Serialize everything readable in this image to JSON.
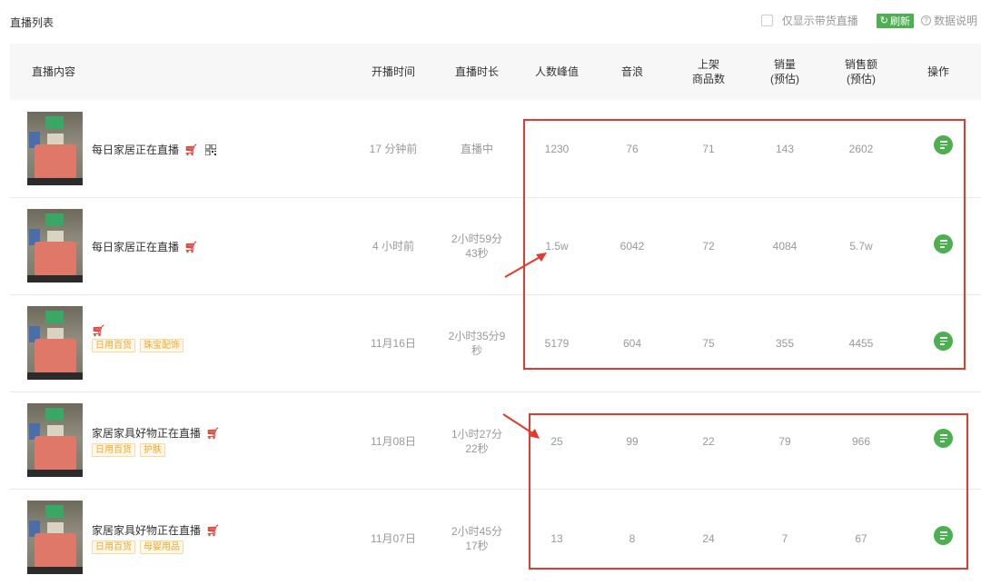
{
  "header": {
    "title": "直播列表",
    "only_goods_label": "仅显示带货直播",
    "refresh_label": "刷新",
    "refresh_icon": "refresh-icon",
    "help_label": "数据说明",
    "help_icon": "help-circle-icon"
  },
  "columns": {
    "content": "直播内容",
    "start_time": "开播时间",
    "duration": "直播时长",
    "peak_viewers": "人数峰值",
    "sound_wave": "音浪",
    "products": "上架\n商品数",
    "sales": "销量\n(预估)",
    "revenue": "销售额\n(预估)",
    "ops": "操作"
  },
  "rows": [
    {
      "title": "每日家居正在直播",
      "tags": [],
      "has_qr": true,
      "start_time": "17 分钟前",
      "duration": "直播中",
      "peak_viewers": "1230",
      "sound_wave": "76",
      "products": "71",
      "sales": "143",
      "revenue": "2602"
    },
    {
      "title": "每日家居正在直播",
      "tags": [],
      "has_qr": false,
      "start_time": "4 小时前",
      "duration": "2小时59分\n43秒",
      "peak_viewers": "1.5w",
      "sound_wave": "6042",
      "products": "72",
      "sales": "4084",
      "revenue": "5.7w"
    },
    {
      "title": "",
      "tags": [
        "日用百货",
        "珠宝配饰"
      ],
      "has_qr": false,
      "start_time": "11月16日",
      "duration": "2小时35分9\n秒",
      "peak_viewers": "5179",
      "sound_wave": "604",
      "products": "75",
      "sales": "355",
      "revenue": "4455"
    },
    {
      "title": "家居家具好物正在直播",
      "tags": [
        "日用百货",
        "护肤"
      ],
      "has_qr": false,
      "start_time": "11月08日",
      "duration": "1小时27分\n22秒",
      "peak_viewers": "25",
      "sound_wave": "99",
      "products": "22",
      "sales": "79",
      "revenue": "966"
    },
    {
      "title": "家居家具好物正在直播",
      "tags": [
        "日用百货",
        "母婴用品"
      ],
      "has_qr": false,
      "start_time": "11月07日",
      "duration": "2小时45分\n17秒",
      "peak_viewers": "13",
      "sound_wave": "8",
      "products": "24",
      "sales": "7",
      "revenue": "67"
    }
  ],
  "colors": {
    "accent_green": "#4caf50",
    "cart_red": "#e0453a",
    "annotation_red": "#e23a2f",
    "tag_orange": "#f5a623"
  }
}
